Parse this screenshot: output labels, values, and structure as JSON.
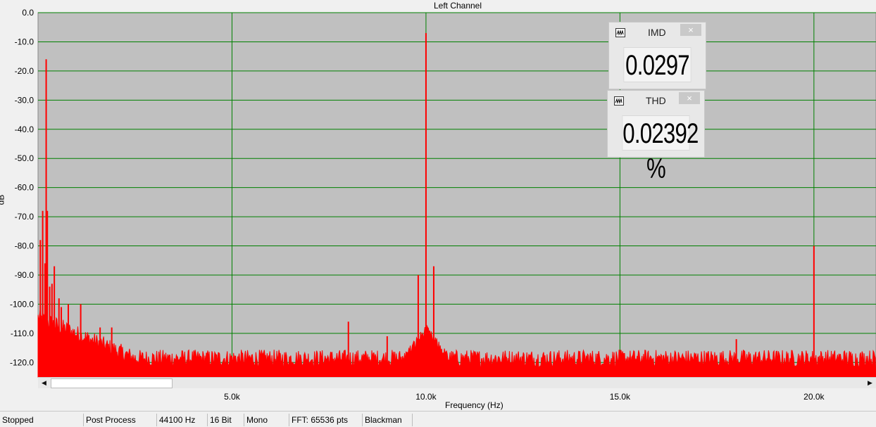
{
  "chart_data": {
    "type": "line",
    "title": "Left Channel",
    "xlabel": "Frequency (Hz)",
    "ylabel": "dB",
    "xlim": [
      0,
      21600
    ],
    "ylim": [
      -125,
      0
    ],
    "xticks": [
      5000,
      10000,
      15000,
      20000
    ],
    "xtick_labels": [
      "5.0k",
      "10.0k",
      "15.0k",
      "20.0k"
    ],
    "yticks": [
      0,
      -10,
      -20,
      -30,
      -40,
      -50,
      -60,
      -70,
      -80,
      -90,
      -100,
      -110,
      -120
    ],
    "ytick_labels": [
      "0.0",
      "-10.0",
      "-20.0",
      "-30.0",
      "-40.0",
      "-50.0",
      "-60.0",
      "-70.0",
      "-80.0",
      "-90.0",
      "-100.0",
      "-110.0",
      "-120.0"
    ],
    "grid": true,
    "noise_floor_db": -121,
    "series": [
      {
        "color": "#ff0000",
        "peaks": [
          {
            "x": 60,
            "y": -78
          },
          {
            "x": 120,
            "y": -68
          },
          {
            "x": 180,
            "y": -86
          },
          {
            "x": 210,
            "y": -16
          },
          {
            "x": 240,
            "y": -68
          },
          {
            "x": 300,
            "y": -94
          },
          {
            "x": 360,
            "y": -93
          },
          {
            "x": 420,
            "y": -87
          },
          {
            "x": 540,
            "y": -98
          },
          {
            "x": 600,
            "y": -101
          },
          {
            "x": 780,
            "y": -100
          },
          {
            "x": 1100,
            "y": -100
          },
          {
            "x": 1600,
            "y": -108
          },
          {
            "x": 1900,
            "y": -108
          },
          {
            "x": 8000,
            "y": -106
          },
          {
            "x": 9000,
            "y": -111
          },
          {
            "x": 9800,
            "y": -90
          },
          {
            "x": 10000,
            "y": -7
          },
          {
            "x": 10200,
            "y": -87
          },
          {
            "x": 20000,
            "y": -80
          },
          {
            "x": 18000,
            "y": -112
          }
        ]
      }
    ]
  },
  "meters": {
    "imd": {
      "title": "IMD",
      "value": "0.0297 %",
      "close": "×"
    },
    "thd": {
      "title": "THD",
      "value": "0.02392 %",
      "close": "×"
    }
  },
  "scrollbar": {
    "left": "◀",
    "right": "▶"
  },
  "status_bar": [
    "Stopped",
    "Post Process",
    "44100 Hz",
    "16 Bit",
    "Mono",
    "FFT: 65536 pts",
    "Blackman"
  ],
  "colors": {
    "plot_bg": "#c0c0c0",
    "grid": "#008000",
    "trace": "#ff0000"
  }
}
